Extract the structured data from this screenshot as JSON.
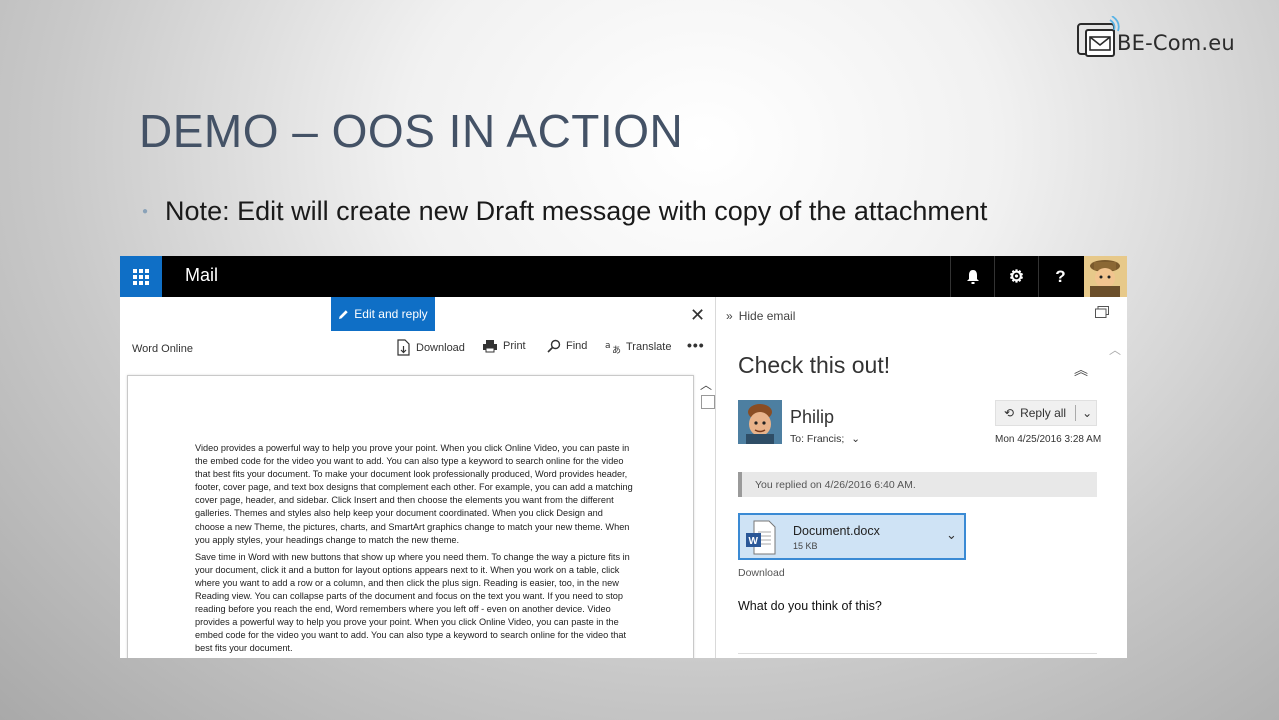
{
  "brand": {
    "logo_text": "BE-Com.eu"
  },
  "slide": {
    "title": "DEMO – OOS IN ACTION",
    "bullet": "Note: Edit will create new Draft message with copy of the attachment"
  },
  "topbar": {
    "app_name": "Mail",
    "bell_label": "",
    "settings_label": "⚙",
    "help_label": "?",
    "bg_color": "#000000",
    "accent_color": "#0f6fc6"
  },
  "doc_pane": {
    "edit_reply_label": "Edit and reply",
    "app_label": "Word Online",
    "download_label": "Download",
    "print_label": "Print",
    "find_label": "Find",
    "translate_label": "Translate",
    "more_label": "•••",
    "close_label": "✕",
    "paragraph_1": "Video provides a powerful way to help you prove your point. When you click Online Video, you can paste in the embed code for the video you want to add. You can also type a keyword to search online for the video that best fits your document. To make your document look professionally produced, Word provides header, footer, cover page, and text box designs that complement each other. For example, you can add a matching cover page, header, and sidebar. Click Insert and then choose the elements you want from the different galleries. Themes and styles also help keep your document coordinated. When you click Design and choose a new Theme, the pictures, charts, and SmartArt graphics change to match your new theme. When you apply styles, your headings change to match the new theme.",
    "paragraph_2": "Save time in Word with new buttons that show up where you need them. To change the way a picture fits in your document, click it and a button for layout options appears next to it. When you work on a table, click where you want to add a row or a column, and then click the plus sign. Reading is easier, too, in the new Reading view. You can collapse parts of the document and focus on the text you want. If you need to stop reading before you reach the end, Word remembers where you left off - even on another device. Video provides a powerful way to help you prove your point. When you click Online Video, you can paste in the embed code for the video you want to add. You can also type a keyword to search online for the video that best fits your document."
  },
  "mail_pane": {
    "hide_email_label": "Hide email",
    "subject": "Check this out!",
    "sender": "Philip",
    "to_line": "To: Francis;",
    "reply_all_label": "Reply all",
    "date": "Mon 4/25/2016 3:28 AM",
    "replied_notice": "You replied on 4/26/2016 6:40 AM.",
    "attachment": {
      "name": "Document.docx",
      "size": "15 KB"
    },
    "download_label": "Download",
    "body": "What do you think of this?"
  }
}
